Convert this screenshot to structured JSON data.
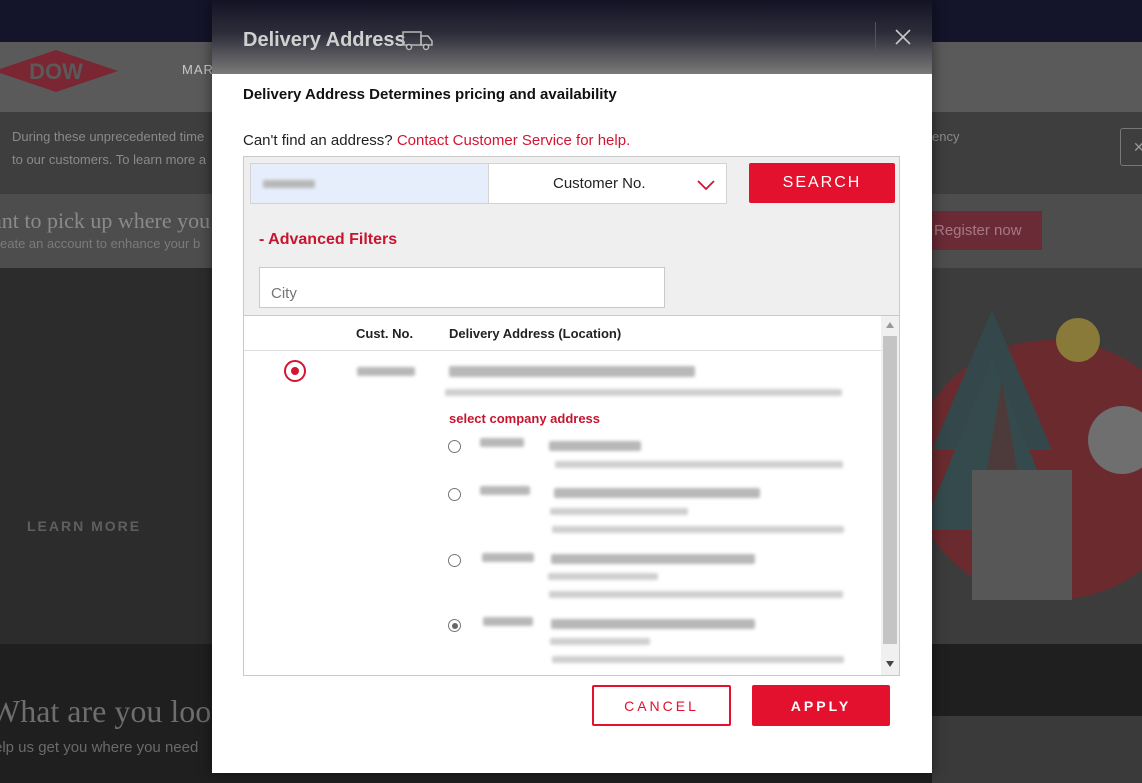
{
  "modal": {
    "title": "Delivery Address",
    "subtitle": "Delivery Address Determines pricing and availability",
    "help_prefix": "Can't find an address?",
    "help_link": "Contact Customer Service for help.",
    "search": {
      "type_selected": "Customer No.",
      "button_label": "SEARCH"
    },
    "advanced_filters_label": "- Advanced Filters",
    "city_placeholder": "City",
    "table": {
      "columns": [
        "Cust. No.",
        "Delivery Address (Location)"
      ],
      "select_company_label": "select company address"
    },
    "buttons": {
      "cancel": "CANCEL",
      "apply": "APPLY"
    }
  },
  "background": {
    "logo": "DOW",
    "nav_item": "MAR",
    "notice_line_1": "During these unprecedented time",
    "notice_line_2": "to our customers. To learn more a",
    "notice_right": "ency",
    "banner_title": "ant to pick up where you",
    "banner_sub": "eate an account to enhance your b",
    "register_label": "Register now",
    "learn_more": "LEARN MORE",
    "bottom_title": "What are you look",
    "bottom_sub": "elp us get you where you need"
  },
  "colors": {
    "brand_red": "#e3112d",
    "link_red": "#d21631"
  }
}
